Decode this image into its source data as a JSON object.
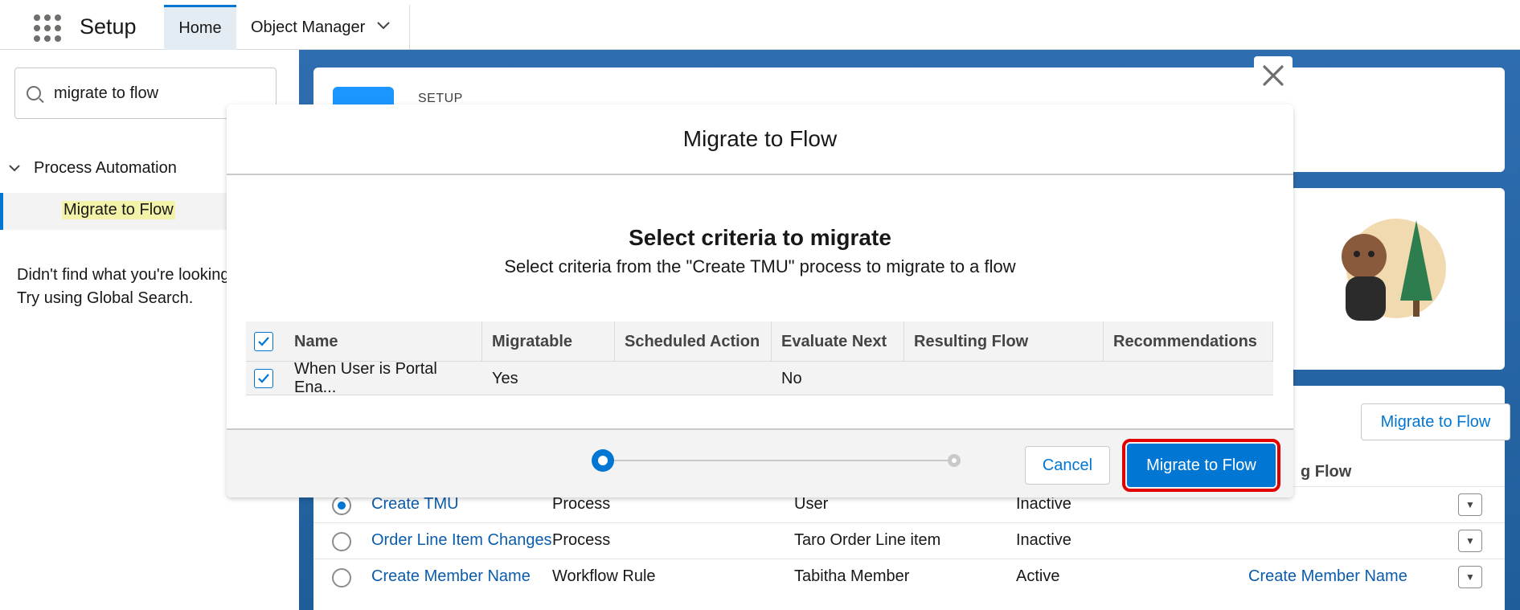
{
  "header": {
    "app_name": "Setup",
    "tabs": [
      {
        "label": "Home"
      },
      {
        "label": "Object Manager"
      }
    ]
  },
  "leftnav": {
    "search_value": "migrate to flow",
    "section_label": "Process Automation",
    "item_label": "Migrate to Flow",
    "hint_line1": "Didn't find what you're looking",
    "hint_line2": "Try using Global Search."
  },
  "background": {
    "setup_label": "SETUP",
    "migrate_button": "Migrate to Flow",
    "column_header_partial": "g Flow",
    "rows": [
      {
        "name": "Create TMU",
        "type": "Process",
        "object": "User",
        "status": "Inactive",
        "resulting": "",
        "selected": true
      },
      {
        "name": "Order Line Item Changes",
        "type": "Process",
        "object": "Taro Order Line item",
        "status": "Inactive",
        "resulting": "",
        "selected": false
      },
      {
        "name": "Create Member Name",
        "type": "Workflow Rule",
        "object": "Tabitha Member",
        "status": "Active",
        "resulting": "Create Member Name",
        "selected": false
      }
    ]
  },
  "modal": {
    "title": "Migrate to Flow",
    "body_title": "Select criteria to migrate",
    "body_subtitle": "Select criteria from the \"Create TMU\" process to migrate to a flow",
    "columns": [
      "Name",
      "Migratable",
      "Scheduled Action",
      "Evaluate Next",
      "Resulting Flow",
      "Recommendations"
    ],
    "rows": [
      {
        "name": "When User is Portal Ena...",
        "migratable": "Yes",
        "scheduled_action": "",
        "evaluate_next": "No",
        "resulting_flow": "",
        "recommendations": ""
      }
    ],
    "cancel_label": "Cancel",
    "migrate_label": "Migrate to Flow",
    "accent_color": "#0176d3",
    "highlight_color": "#e00000"
  }
}
